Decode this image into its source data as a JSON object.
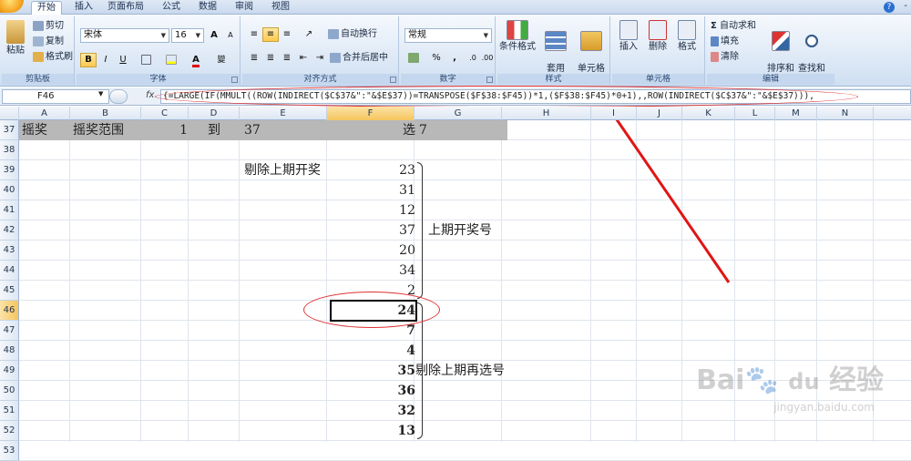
{
  "tabs": [
    "开始",
    "插入",
    "页面布局",
    "公式",
    "数据",
    "审阅",
    "视图"
  ],
  "ribbon": {
    "clipboard": {
      "paste": "粘贴",
      "cut": "剪切",
      "copy": "复制",
      "format_painter": "格式刷",
      "label": "剪贴板"
    },
    "font": {
      "name": "宋体",
      "size": "16",
      "bold": "B",
      "italic": "I",
      "underline": "U",
      "grow": "A",
      "shrink": "A",
      "label": "字体"
    },
    "alignment": {
      "wrap": "自动换行",
      "merge": "合并后居中",
      "label": "对齐方式"
    },
    "number": {
      "format": "常规",
      "percent": "%",
      "comma": ",",
      "label": "数字"
    },
    "styles": {
      "conditional": "条件格式",
      "table": "套用\n表格格式",
      "cell": "单元格\n样式",
      "label": "样式"
    },
    "cells": {
      "insert": "插入",
      "delete": "删除",
      "format": "格式",
      "label": "单元格"
    },
    "editing": {
      "autosum": "自动求和",
      "fill": "填充",
      "clear": "清除",
      "sort": "排序和\n筛选",
      "find": "查找和\n选择",
      "label": "编辑"
    }
  },
  "formula_bar": {
    "name_box": "F46",
    "fx": "fx",
    "formula": "{=LARGE(IF(MMULT((ROW(INDIRECT($C$37&\":\"&$E$37))=TRANSPOSE($F$38:$F45))*1,($F$38:$F45)*0+1),,ROW(INDIRECT($C$37&\":\"&$E$37))),"
  },
  "columns": [
    "A",
    "B",
    "C",
    "D",
    "E",
    "F",
    "G",
    "H",
    "I",
    "J",
    "K",
    "L",
    "M",
    "N"
  ],
  "rows": [
    "37",
    "38",
    "39",
    "40",
    "41",
    "42",
    "43",
    "44",
    "45",
    "46",
    "47",
    "48",
    "49",
    "50",
    "51",
    "52",
    "53"
  ],
  "cells": {
    "a37": "摇奖",
    "b37": "摇奖范围",
    "c37": "1",
    "d37": "到",
    "e37": "37",
    "f37": "选",
    "g37": "7",
    "e39": "剔除上期开奖",
    "prev": [
      "23",
      "31",
      "12",
      "37",
      "20",
      "34",
      "2"
    ],
    "new": [
      "24",
      "7",
      "4",
      "35",
      "36",
      "32",
      "13"
    ],
    "label_prev": "上期开奖号",
    "label_new": "剔除上期再选号"
  },
  "watermark": {
    "brand": "Bai",
    "tail": "经验",
    "url": "jingyan.baidu.com"
  },
  "colors": {
    "accent": "#e03030",
    "header": "#dde7f3",
    "selected": "#f5c55e"
  }
}
